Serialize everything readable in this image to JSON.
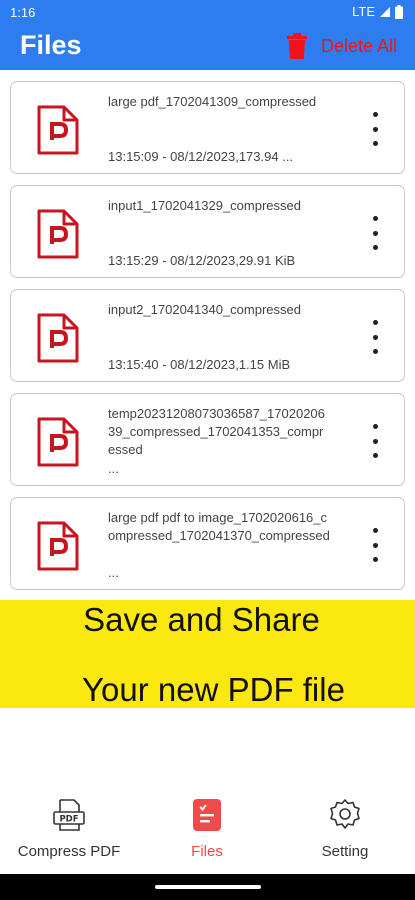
{
  "status": {
    "time": "1:16",
    "network": "LTE"
  },
  "app_bar": {
    "title": "Files",
    "delete_all_label": "Delete All",
    "accent_color": "#2e7df0",
    "delete_color": "#f0141a"
  },
  "files": [
    {
      "name": "large pdf_1702041309_compressed",
      "meta": "13:15:09 - 08/12/2023,173.94 ..."
    },
    {
      "name": "input1_1702041329_compressed",
      "meta": "13:15:29 - 08/12/2023,29.91 KiB"
    },
    {
      "name": "input2_1702041340_compressed",
      "meta": "13:15:40 - 08/12/2023,1.15 MiB"
    },
    {
      "name": "temp20231208073036587_1702020639_compressed_1702041353_compressed",
      "meta": "..."
    },
    {
      "name": "large pdf pdf to image_1702020616_compressed_1702041370_compressed",
      "meta": "..."
    }
  ],
  "promo": {
    "line1": "Save and Share",
    "line2": "Your new PDF file",
    "background": "#fbe80e"
  },
  "nav": {
    "compress_label": "Compress PDF",
    "files_label": "Files",
    "setting_label": "Setting",
    "compress_icon_text": "PDF",
    "active_color": "#f04a4a"
  }
}
